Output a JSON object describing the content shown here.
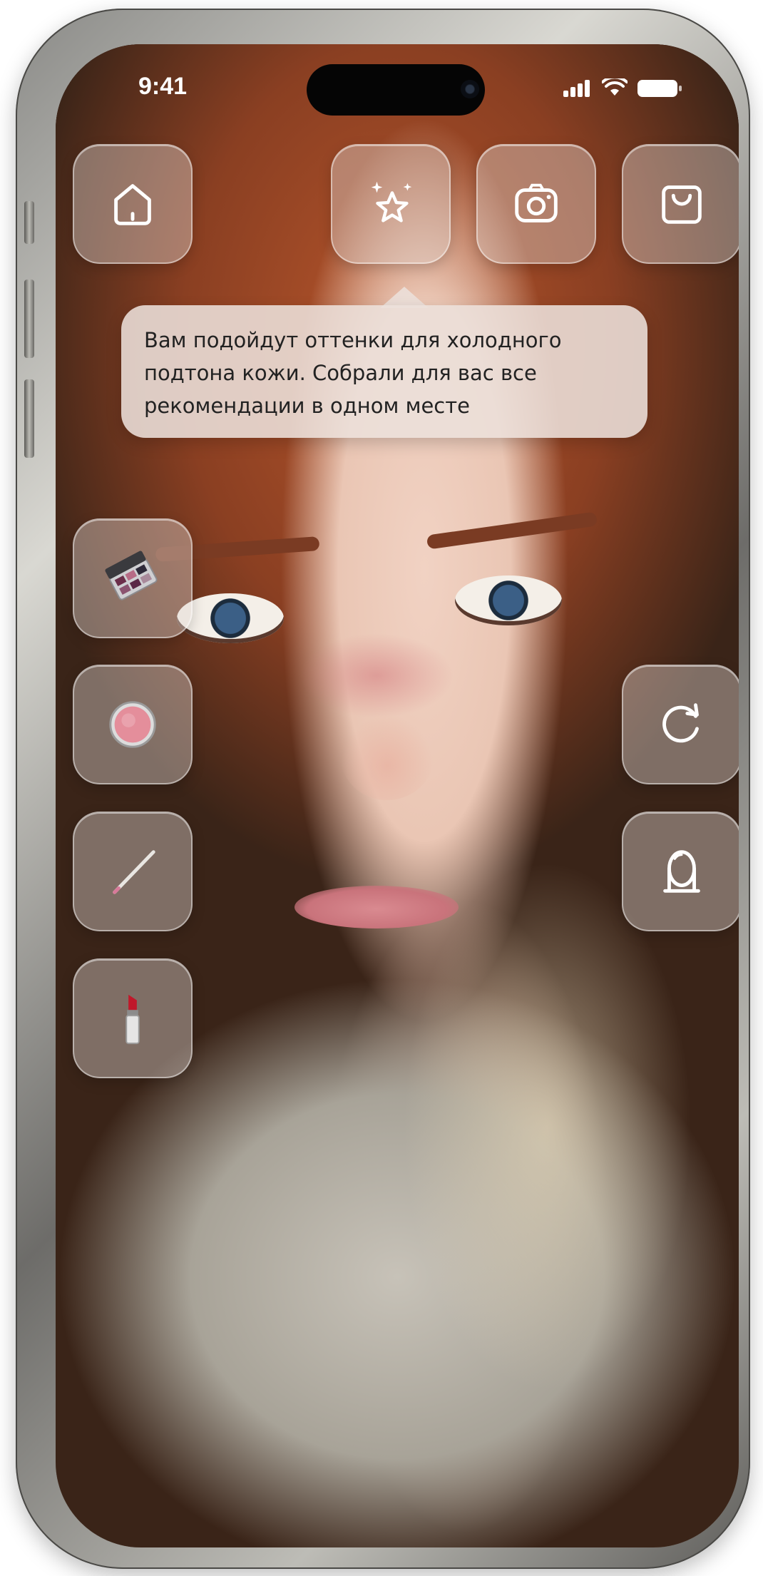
{
  "status_bar": {
    "time": "9:41"
  },
  "toolbar": {
    "home": {
      "icon": "home-icon"
    },
    "ai_recommendations": {
      "icon": "sparkles-star-icon"
    },
    "camera": {
      "icon": "camera-icon"
    },
    "shopping": {
      "icon": "shopping-bag-icon"
    }
  },
  "tooltip": {
    "line1": "Вам подойдут оттенки для холодного",
    "line2": "подтона кожи. Собрали для вас все",
    "line3": "рекомендации в одном месте"
  },
  "makeup_tools": [
    {
      "icon": "eyeshadow-palette-icon"
    },
    {
      "icon": "blush-compact-icon"
    },
    {
      "icon": "eyeliner-pencil-icon"
    },
    {
      "icon": "lipstick-icon"
    }
  ],
  "right_tools": [
    {
      "icon": "refresh-icon"
    },
    {
      "icon": "mirror-icon"
    }
  ]
}
